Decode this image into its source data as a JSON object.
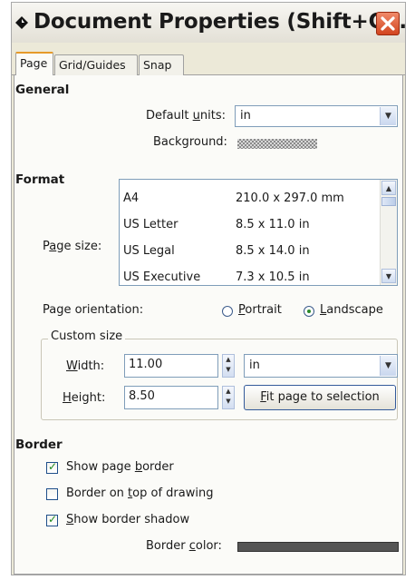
{
  "window": {
    "title": "Document Properties (Shift+C...",
    "tabs": [
      {
        "label": "Page",
        "active": true
      },
      {
        "label": "Grid/Guides",
        "active": false
      },
      {
        "label": "Snap",
        "active": false
      }
    ]
  },
  "general": {
    "heading": "General",
    "default_units_label_pre": "Default ",
    "default_units_label_u": "u",
    "default_units_label_post": "nits:",
    "default_units_value": "in",
    "background_label": "Background:"
  },
  "format": {
    "heading": "Format",
    "page_size_label_pre": "P",
    "page_size_label_u": "a",
    "page_size_label_post": "ge size:",
    "page_sizes": [
      {
        "name": "A4",
        "size": "210.0 x 297.0 mm"
      },
      {
        "name": "US Letter",
        "size": "8.5 x 11.0 in"
      },
      {
        "name": "US Legal",
        "size": "8.5 x 14.0 in"
      },
      {
        "name": "US Executive",
        "size": "7.3 x 10.5 in"
      }
    ],
    "orientation_label": "Page orientation:",
    "portrait_u": "P",
    "portrait_rest": "ortrait",
    "landscape_u": "L",
    "landscape_rest": "andscape",
    "orientation_selected": "Landscape"
  },
  "custom_size": {
    "title": "Custom size",
    "width_u": "W",
    "width_rest": "idth:",
    "width_value": "11.00",
    "height_u": "H",
    "height_rest": "eight:",
    "height_value": "8.50",
    "units_value": "in",
    "fit_u": "F",
    "fit_rest": "it page to selection"
  },
  "border": {
    "heading": "Border",
    "show_page_border_pre": "Show page ",
    "show_page_border_u": "b",
    "show_page_border_post": "order",
    "show_page_border_checked": true,
    "border_on_top_pre": "Border on ",
    "border_on_top_u": "t",
    "border_on_top_post": "op of drawing",
    "border_on_top_checked": false,
    "show_shadow_u": "S",
    "show_shadow_rest": "how border shadow",
    "show_shadow_checked": true,
    "border_color_pre": "Border ",
    "border_color_u": "c",
    "border_color_post": "olor:",
    "border_color_value": "#555555"
  },
  "icons": {
    "title": "inkscape-diamond-icon",
    "close": "close-icon"
  }
}
